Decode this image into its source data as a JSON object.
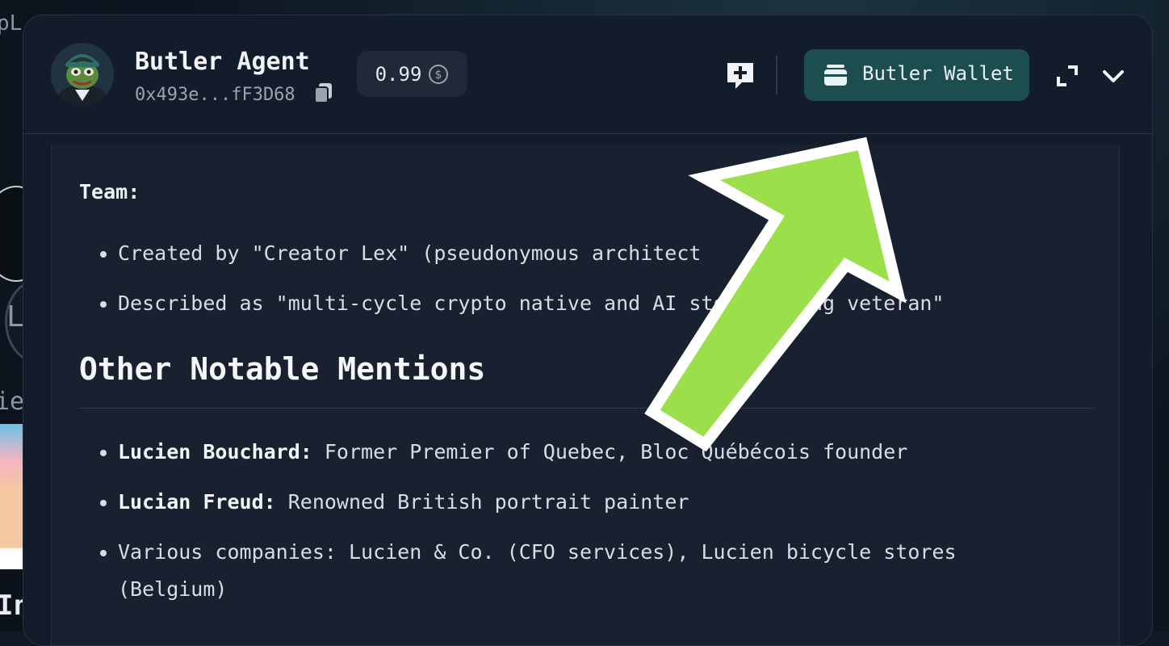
{
  "header": {
    "agent_name": "Butler Agent",
    "agent_address": "0x493e...fF3D68",
    "balance_value": "0.99",
    "wallet_button_label": "Butler Wallet"
  },
  "content": {
    "team_heading": "Team:",
    "team_items": [
      "Created by \"Creator Lex\" (pseudonymous architect",
      "Described as \"multi-cycle crypto native and AI storytelling veteran\""
    ],
    "section_heading": "Other Notable Mentions",
    "mentions": [
      {
        "name": "Lucien Bouchard:",
        "text": " Former Premier of Quebec, Bloc Québécois founder"
      },
      {
        "name": "Lucian Freud:",
        "text": " Renowned British portrait painter"
      },
      {
        "name": "",
        "text": "Various companies: Lucien & Co. (CFO services), Lucien bicycle stores (Belgium)"
      }
    ]
  },
  "background": {
    "partial_text_1": "pL",
    "partial_text_2": "L",
    "partial_text_3": "ie",
    "partial_text_4": "In"
  },
  "colors": {
    "panel_bg": "#131c2b",
    "content_bg": "#19202f",
    "wallet_button_bg": "#1d4e4f",
    "arrow_fill": "#9be04a",
    "arrow_stroke": "#ffffff"
  },
  "icons": {
    "copy": "copy-icon",
    "dollar": "dollar-circle-icon",
    "chat": "chat-plus-icon",
    "wallet": "wallet-icon",
    "expand": "expand-icon",
    "collapse": "chevron-down-icon",
    "annotation": "arrow-annotation"
  }
}
